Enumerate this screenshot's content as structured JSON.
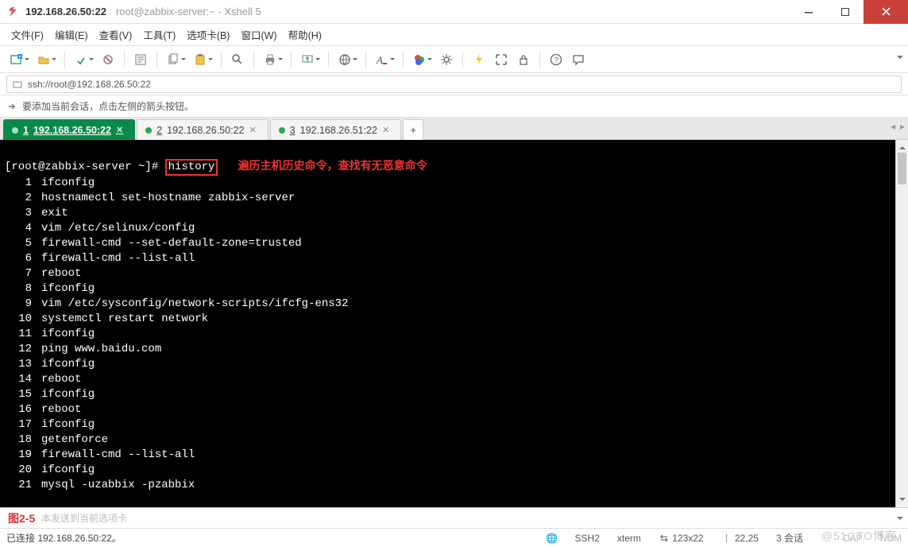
{
  "window": {
    "ip_title": "192.168.26.50:22",
    "sub_title": "root@zabbix-server:~ - Xshell 5"
  },
  "menu": {
    "file": "文件(F)",
    "edit": "编辑(E)",
    "view": "查看(V)",
    "tools": "工具(T)",
    "tabs": "选项卡(B)",
    "window": "窗口(W)",
    "help": "帮助(H)"
  },
  "address": {
    "url": "ssh://root@192.168.26.50:22"
  },
  "hint": {
    "text": "要添加当前会话，点击左侧的箭头按钮。"
  },
  "tabs": [
    {
      "index": "1",
      "label": "192.168.26.50:22",
      "active": true
    },
    {
      "index": "2",
      "label": "192.168.26.50:22",
      "active": false
    },
    {
      "index": "3",
      "label": "192.168.26.51:22",
      "active": false
    }
  ],
  "terminal": {
    "prompt": "[root@zabbix-server ~]# ",
    "highlight_cmd": "history",
    "annotation": "遍历主机历史命令，查找有无恶意命令",
    "history": [
      {
        "n": "1",
        "cmd": "ifconfig"
      },
      {
        "n": "2",
        "cmd": "hostnamectl set-hostname zabbix-server"
      },
      {
        "n": "3",
        "cmd": "exit"
      },
      {
        "n": "4",
        "cmd": "vim /etc/selinux/config"
      },
      {
        "n": "5",
        "cmd": "firewall-cmd --set-default-zone=trusted"
      },
      {
        "n": "6",
        "cmd": "firewall-cmd --list-all"
      },
      {
        "n": "7",
        "cmd": "reboot"
      },
      {
        "n": "8",
        "cmd": "ifconfig"
      },
      {
        "n": "9",
        "cmd": "vim /etc/sysconfig/network-scripts/ifcfg-ens32"
      },
      {
        "n": "10",
        "cmd": "systemctl restart network"
      },
      {
        "n": "11",
        "cmd": "ifconfig"
      },
      {
        "n": "12",
        "cmd": "ping www.baidu.com"
      },
      {
        "n": "13",
        "cmd": "ifconfig"
      },
      {
        "n": "14",
        "cmd": "reboot"
      },
      {
        "n": "15",
        "cmd": "ifconfig"
      },
      {
        "n": "16",
        "cmd": "reboot"
      },
      {
        "n": "17",
        "cmd": "ifconfig"
      },
      {
        "n": "18",
        "cmd": "getenforce"
      },
      {
        "n": "19",
        "cmd": "firewall-cmd --list-all"
      },
      {
        "n": "20",
        "cmd": "ifconfig"
      },
      {
        "n": "21",
        "cmd": "mysql -uzabbix -pzabbix"
      }
    ]
  },
  "compose": {
    "placeholder": "本发送到当前选项卡",
    "figure_label": "图2-5"
  },
  "status": {
    "connected": "已连接 192.168.26.50:22。",
    "protocol": "SSH2",
    "term": "xterm",
    "size": "123x22",
    "cursor": "22,25",
    "sessions": "3 会话"
  },
  "icons": {
    "capslock": "CAP",
    "numlock": "NUM",
    "size_icon": "⇹",
    "cursor_icon": "⁞",
    "lock_icon": "🔒",
    "globe": "🌐",
    "watermark": "@51CTO博客"
  }
}
